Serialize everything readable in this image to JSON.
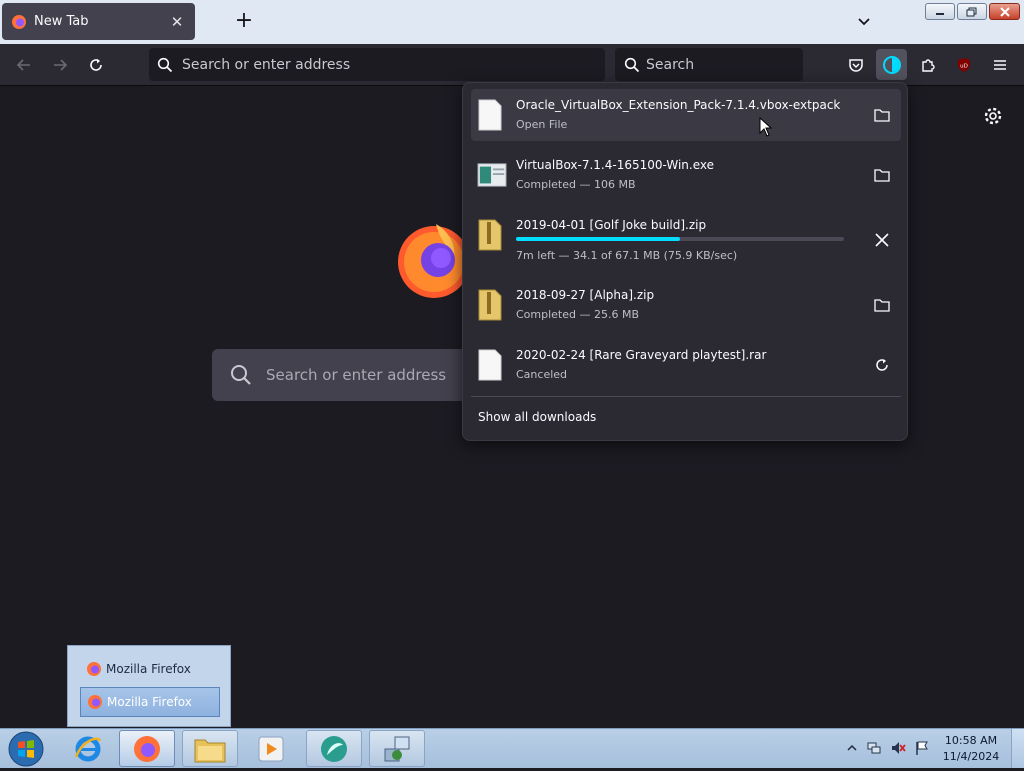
{
  "tab": {
    "title": "New Tab"
  },
  "toolbar": {
    "address_placeholder": "Search or enter address",
    "search_placeholder": "Search"
  },
  "content": {
    "search_placeholder": "Search or enter address"
  },
  "downloads": {
    "items": [
      {
        "name": "Oracle_VirtualBox_Extension_Pack-7.1.4.vbox-extpack",
        "status": "Open File",
        "action": "folder-icon"
      },
      {
        "name": "VirtualBox-7.1.4-165100-Win.exe",
        "status": "Completed — 106 MB",
        "action": "folder-icon"
      },
      {
        "name": "2019-04-01 [Golf Joke build].zip",
        "status": "7m left — 34.1 of 67.1 MB (75.9 KB/sec)",
        "action": "cancel-icon",
        "progress": 0.5
      },
      {
        "name": "2018-09-27 [Alpha].zip",
        "status": "Completed — 25.6 MB",
        "action": "folder-icon"
      },
      {
        "name": "2020-02-24 [Rare Graveyard playtest].rar",
        "status": "Canceled",
        "action": "retry-icon"
      }
    ],
    "show_all": "Show all downloads"
  },
  "jumplist": {
    "items": [
      "Mozilla Firefox",
      "Mozilla Firefox"
    ]
  },
  "taskbar": {
    "time": "10:58 AM",
    "date": "11/4/2024"
  },
  "colors": {
    "accent": "#00ddff",
    "panel": "#2b2a33",
    "background": "#1c1b22"
  }
}
